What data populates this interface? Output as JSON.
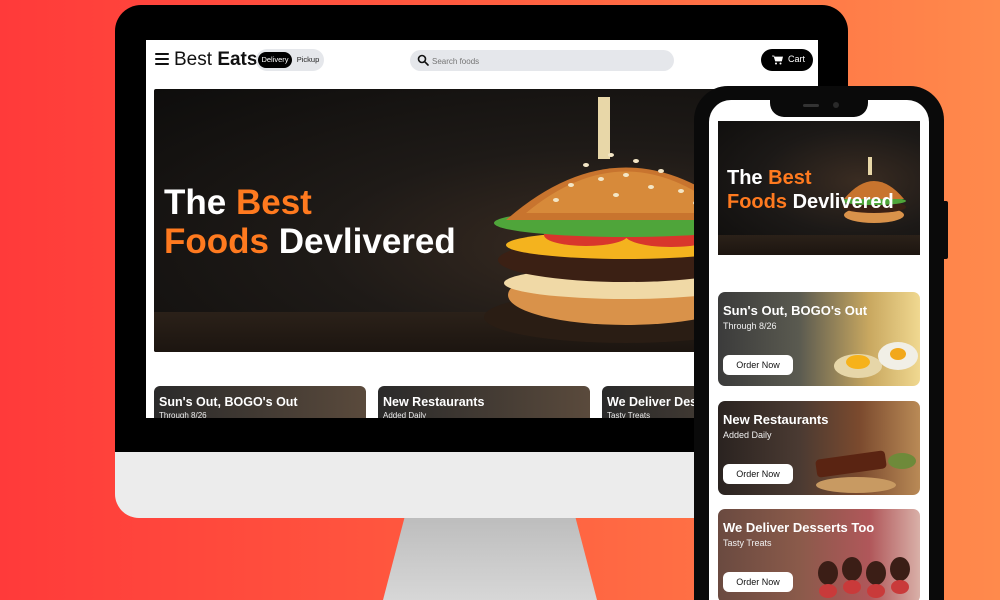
{
  "brand": {
    "prefix": "Best",
    "bold": "Eats"
  },
  "nav": {
    "delivery_label": "Delivery",
    "pickup_label": "Pickup",
    "search_placeholder": "Search foods",
    "cart_label": "Cart"
  },
  "hero": {
    "line1_plain": "The",
    "line1_accent": "Best",
    "line2_accent": "Foods",
    "line2_plain": "Devlivered"
  },
  "promos": [
    {
      "title": "Sun's Out, BOGO's Out",
      "subtitle": "Through 8/26",
      "cta": "Order Now"
    },
    {
      "title": "New Restaurants",
      "subtitle": "Added Daily",
      "cta": "Order Now"
    },
    {
      "title": "We Deliver Desserts Too",
      "subtitle": "Tasty Treats",
      "cta": "Order Now"
    }
  ],
  "desktop_promo_titles_visible": [
    "Sun's Out, BOGO's Out",
    "New Restaurants",
    "We Deliver Des"
  ],
  "colors": {
    "accent": "#ff7a1f",
    "background_left": "#ff3a3a",
    "background_right": "#ff8a4c"
  },
  "icons": [
    "menu-icon",
    "search-icon",
    "cart-icon"
  ]
}
